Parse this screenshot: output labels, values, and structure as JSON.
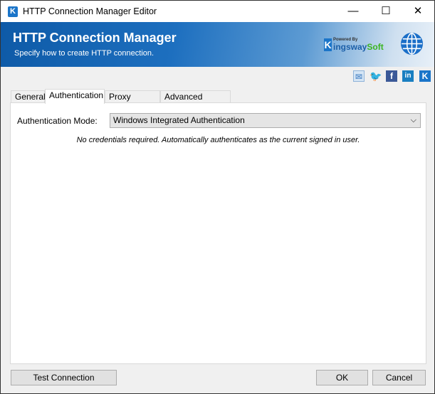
{
  "window": {
    "title": "HTTP Connection Manager Editor",
    "minimize": "—",
    "maximize": "☐",
    "close": "✕"
  },
  "banner": {
    "title": "HTTP Connection Manager",
    "subtitle": "Specify how to create HTTP connection.",
    "logo_powered": "Powered By",
    "logo_brand_a": "ingsway",
    "logo_brand_b": "Soft",
    "logo_k": "K"
  },
  "social": [
    "email-icon",
    "twitter-icon",
    "facebook-icon",
    "linkedin-icon",
    "kingswaysoft-icon"
  ],
  "tabs": [
    {
      "label": "General"
    },
    {
      "label": "Authentication",
      "active": true
    },
    {
      "label": "Proxy Settings"
    },
    {
      "label": "Advanced Settings"
    }
  ],
  "auth": {
    "mode_label": "Authentication Mode:",
    "mode_value": "Windows Integrated Authentication",
    "note": "No credentials required. Automatically authenticates as the current signed in user."
  },
  "buttons": {
    "test": "Test Connection",
    "ok": "OK",
    "cancel": "Cancel"
  }
}
